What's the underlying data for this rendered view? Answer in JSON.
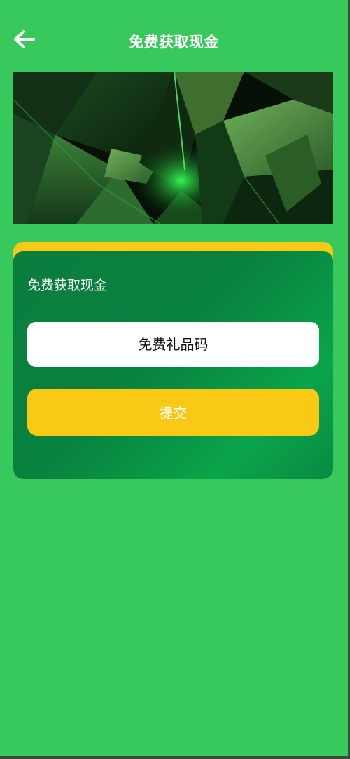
{
  "header": {
    "title": "免费获取现金",
    "back_icon": "arrow-left-icon"
  },
  "banner": {
    "description_icon": "abstract-green-shards-image"
  },
  "card": {
    "title": "免费获取现金",
    "input_placeholder": "免费礼品码",
    "submit_label": "提交"
  },
  "colors": {
    "page_background": "#38c95d",
    "card_accent": "#f9c916",
    "card_background": "#0b7d3e",
    "text_light": "#ffffff"
  }
}
